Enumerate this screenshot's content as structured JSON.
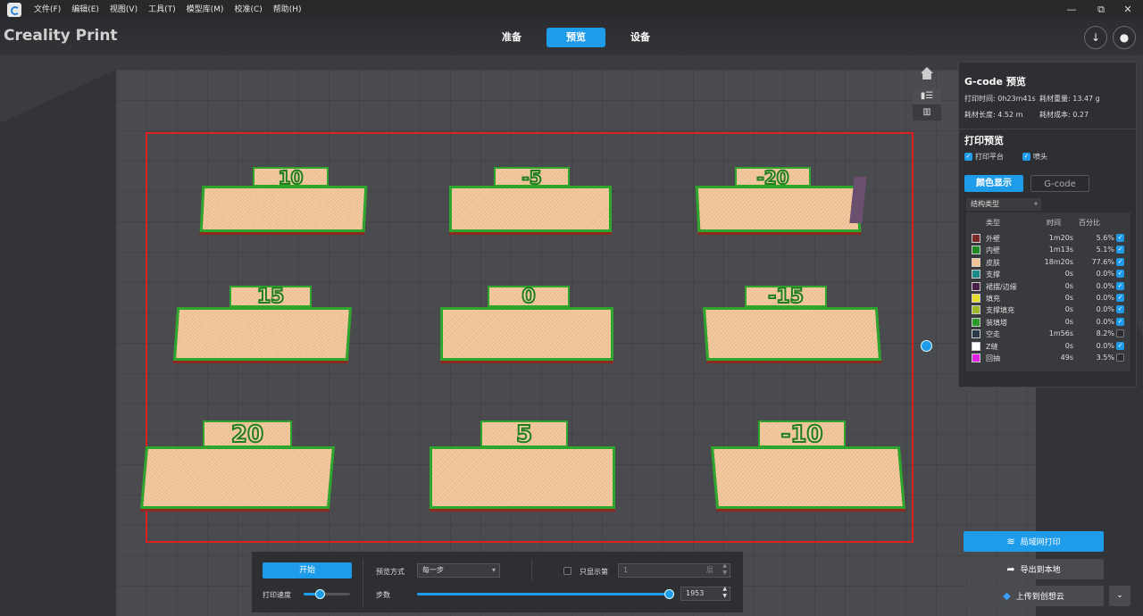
{
  "menu": [
    "文件(F)",
    "编辑(E)",
    "视图(V)",
    "工具(T)",
    "模型库(M)",
    "校准(C)",
    "帮助(H)"
  ],
  "window_controls": {
    "minimize": "—",
    "maximize": "⧉",
    "close": "✕"
  },
  "brand": "Creality Print",
  "tabs": [
    {
      "label": "准备"
    },
    {
      "label": "预览"
    },
    {
      "label": "设备"
    }
  ],
  "active_tab": 1,
  "header_icons": {
    "download": "download-icon",
    "account": "user-icon"
  },
  "parts": [
    {
      "tag": "10"
    },
    {
      "tag": "-5"
    },
    {
      "tag": "-20"
    },
    {
      "tag": "15"
    },
    {
      "tag": "0"
    },
    {
      "tag": "-15"
    },
    {
      "tag": "20"
    },
    {
      "tag": "5"
    },
    {
      "tag": "-10"
    }
  ],
  "gcode_panel": {
    "title": "G-code 预览",
    "print_time": "打印时间: 0h23m41s",
    "filament_weight": "耗材重量: 13.47 g",
    "filament_length": "耗材长度: 4.52 m",
    "filament_cost": "耗材成本: 0.27",
    "print_preview_title": "打印预览",
    "show_plate": "打印平台",
    "show_nozzle": "喷头",
    "btn_color": "颜色显示",
    "btn_gcode": "G-code",
    "structure_select": "结构类型",
    "legend_headers": {
      "type": "类型",
      "time": "时间",
      "percent": "百分比"
    },
    "legend": [
      {
        "name": "外壁",
        "time": "1m20s",
        "percent": "5.6%",
        "color": "#7a2a24",
        "checked": true
      },
      {
        "name": "内壁",
        "time": "1m13s",
        "percent": "5.1%",
        "color": "#1f8a1f",
        "checked": true
      },
      {
        "name": "皮肤",
        "time": "18m20s",
        "percent": "77.6%",
        "color": "#f2c497",
        "checked": true
      },
      {
        "name": "支撑",
        "time": "0s",
        "percent": "0.0%",
        "color": "#1a8a8a",
        "checked": true
      },
      {
        "name": "裙摆/边缘",
        "time": "0s",
        "percent": "0.0%",
        "color": "#4a1f4a",
        "checked": true
      },
      {
        "name": "填充",
        "time": "0s",
        "percent": "0.0%",
        "color": "#e8dd2a",
        "checked": true
      },
      {
        "name": "支撑填充",
        "time": "0s",
        "percent": "0.0%",
        "color": "#9ab82a",
        "checked": true
      },
      {
        "name": "装填塔",
        "time": "0s",
        "percent": "0.0%",
        "color": "#2a9a2a",
        "checked": true
      },
      {
        "name": "空走",
        "time": "1m56s",
        "percent": "8.2%",
        "color": "#2a3a4a",
        "checked": false
      },
      {
        "name": "Z缝",
        "time": "0s",
        "percent": "0.0%",
        "color": "#ffffff",
        "checked": true
      },
      {
        "name": "回抽",
        "time": "49s",
        "percent": "3.5%",
        "color": "#e020e0",
        "checked": false
      }
    ]
  },
  "bottom": {
    "start": "开始",
    "speed_label": "打印速度",
    "speed_level": 0.35,
    "preview_mode_label": "预览方式",
    "preview_mode": "每一步",
    "only_show_label": "只显示第",
    "only_show_value": "1",
    "layer_unit": "层",
    "steps_label": "步数",
    "steps_value": "1953",
    "steps_level": 1.0
  },
  "right_buttons": {
    "lan": "局域网打印",
    "export": "导出到本地",
    "cloud": "上传到创想云"
  }
}
